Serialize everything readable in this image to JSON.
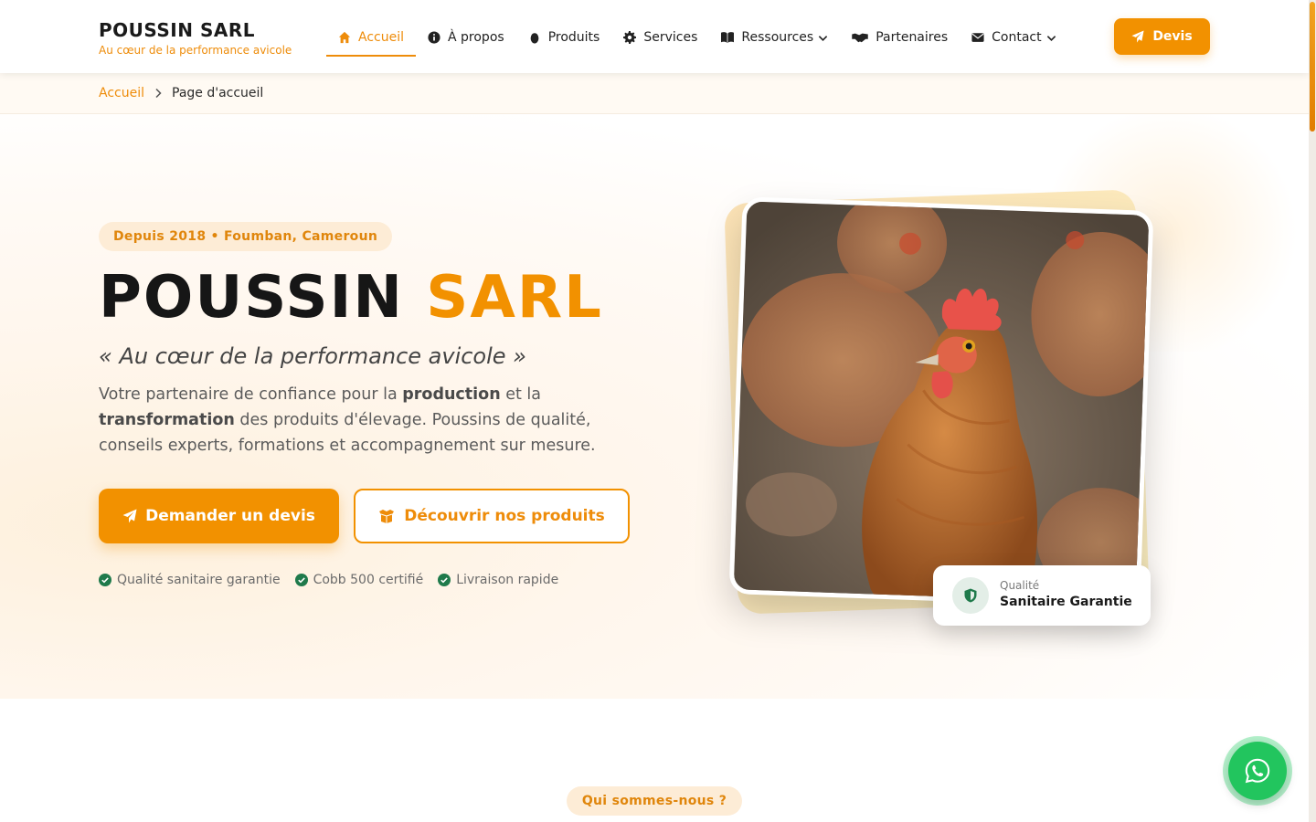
{
  "brand": {
    "name": "POUSSIN SARL",
    "tagline": "Au cœur de la performance avicole"
  },
  "nav": {
    "items": [
      {
        "label": "Accueil",
        "icon": "home-icon",
        "active": true
      },
      {
        "label": "À propos",
        "icon": "info-icon"
      },
      {
        "label": "Produits",
        "icon": "egg-icon"
      },
      {
        "label": "Services",
        "icon": "gear-icon"
      },
      {
        "label": "Ressources",
        "icon": "book-icon",
        "dropdown": true
      },
      {
        "label": "Partenaires",
        "icon": "handshake-icon"
      },
      {
        "label": "Contact",
        "icon": "envelope-icon",
        "dropdown": true
      }
    ],
    "cta_label": "Devis"
  },
  "breadcrumb": {
    "home": "Accueil",
    "current": "Page d'accueil"
  },
  "hero": {
    "badge": "Depuis 2018 • Foumban, Cameroun",
    "title_part1": "POUSSIN",
    "title_part2": "SARL",
    "quote": "« Au cœur de la performance avicole »",
    "desc_1": "Votre partenaire de confiance pour la ",
    "desc_bold_1": "production",
    "desc_2": " et la ",
    "desc_bold_2": "transformation",
    "desc_3": " des produits d'élevage. Poussins de qualité, conseils experts, formations et accompagnement sur mesure.",
    "primary_button": "Demander un devis",
    "secondary_button": "Découvrir nos produits",
    "features": [
      "Qualité sanitaire garantie",
      "Cobb 500 certifié",
      "Livraison rapide"
    ],
    "quality_card": {
      "label": "Qualité",
      "value": "Sanitaire Garantie"
    }
  },
  "about_section": {
    "badge": "Qui sommes-nous ?"
  },
  "colors": {
    "accent": "#f29100",
    "accent_soft": "#fdecd6",
    "success": "#1f7a4b",
    "whatsapp": "#22c55e"
  }
}
